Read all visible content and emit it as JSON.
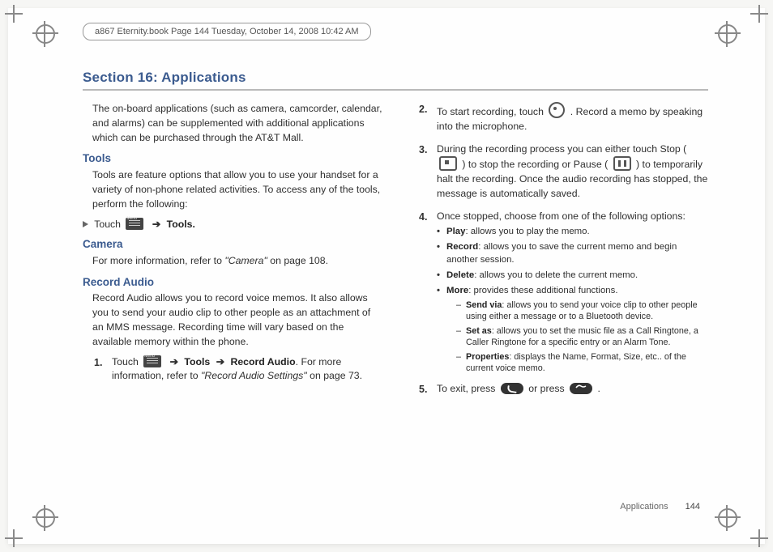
{
  "runhead": "a867 Eternity.book  Page 144  Tuesday, October 14, 2008  10:42 AM",
  "section_title": "Section 16: Applications",
  "intro": "The on-board applications (such as camera, camcorder, calendar, and alarms) can be supplemented with additional applications which can be purchased through the AT&T Mall.",
  "tools": {
    "heading": "Tools",
    "body": "Tools are feature options that allow you to use your handset for a variety of non-phone related activities. To access any of the tools, perform the following:",
    "touch_word": "Touch",
    "arrow": "➔",
    "tools_label": "Tools."
  },
  "camera": {
    "heading": "Camera",
    "body_pre": "For more information, refer to ",
    "ref": "\"Camera\"",
    "body_post": "  on page 108."
  },
  "record": {
    "heading": "Record Audio",
    "body": "Record Audio allows you to record voice memos. It also allows you to send your audio clip to other people as an attachment of an MMS message. Recording time will vary based on the available memory within the phone.",
    "steps": {
      "s1": {
        "num": "1.",
        "pre": "Touch ",
        "arrow": "➔",
        "tools": "Tools",
        "rec": "Record Audio",
        "post1": ". For more information, refer to ",
        "ref": "\"Record Audio Settings\"",
        "post2": "  on page 73."
      },
      "s2": {
        "num": "2.",
        "pre": "To start recording, touch  ",
        "post": ". Record a memo by speaking into the microphone."
      },
      "s3": {
        "num": "3.",
        "pre": "During the recording process you can either touch Stop ( ",
        "mid": " ) to stop the recording or Pause ( ",
        "post": " ) to temporarily halt the recording. Once the audio recording has stopped, the message is automatically saved."
      },
      "s4": {
        "num": "4.",
        "lead": "Once stopped, choose from one of the following options:",
        "opts": {
          "play_b": "Play",
          "play": ": allows you to play the memo.",
          "record_b": "Record",
          "record": ": allows you to save the current memo and begin another session.",
          "delete_b": "Delete",
          "delete": ": allows you to delete the current memo.",
          "more_b": "More",
          "more": ": provides these additional functions.",
          "sendvia_b": "Send via",
          "sendvia": ": allows you to send your voice clip to other people using either a message or to a Bluetooth device.",
          "setas_b": "Set as",
          "setas": ": allows you to set the music file as a Call Ringtone, a Caller Ringtone for a specific entry or an Alarm Tone.",
          "props_b": "Properties",
          "props": ": displays the Name, Format, Size, etc.. of the current voice memo."
        }
      },
      "s5": {
        "num": "5.",
        "pre": "To exit, press ",
        "mid": " or press ",
        "post": "."
      }
    }
  },
  "footer": {
    "label": "Applications",
    "page": "144"
  }
}
